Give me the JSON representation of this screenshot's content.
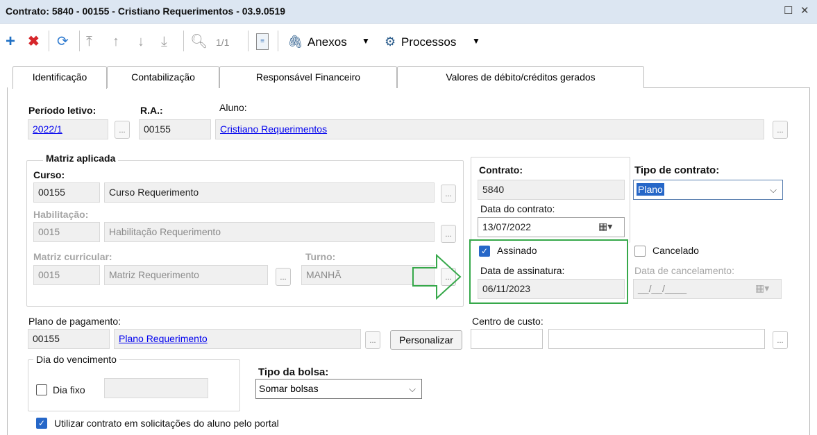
{
  "window": {
    "title": "Contrato: 5840 - 00155 - Cristiano Requerimentos - 03.9.0519"
  },
  "toolbar": {
    "record_counter": "1/1",
    "anexos_label": "Anexos",
    "processos_label": "Processos"
  },
  "tabs": [
    {
      "label": "Identificação"
    },
    {
      "label": "Contabilização"
    },
    {
      "label": "Responsável Financeiro"
    },
    {
      "label": "Valores de débito/créditos gerados"
    }
  ],
  "form": {
    "periodo_label": "Período letivo:",
    "periodo_value": "2022/1",
    "ra_label": "R.A.:",
    "ra_value": "00155",
    "aluno_label": "Aluno:",
    "aluno_value": "Cristiano Requerimentos",
    "matriz_title": "Matriz aplicada",
    "curso_label": "Curso:",
    "curso_code": "00155",
    "curso_name": "Curso Requerimento",
    "habilitacao_label": "Habilitação:",
    "habilitacao_code": "0015",
    "habilitacao_name": "Habilitação Requerimento",
    "matriz_label": "Matriz curricular:",
    "matriz_code": "0015",
    "matriz_name": "Matriz Requerimento",
    "turno_label": "Turno:",
    "turno_value": "MANHÃ",
    "contrato_label": "Contrato:",
    "contrato_value": "5840",
    "tipo_contrato_label": "Tipo de contrato:",
    "tipo_contrato_value": "Plano",
    "data_contrato_label": "Data do contrato:",
    "data_contrato_value": "13/07/2022",
    "assinado_label": "Assinado",
    "assinado_checked": true,
    "data_assinatura_label": "Data de assinatura:",
    "data_assinatura_value": "06/11/2023",
    "cancelado_label": "Cancelado",
    "data_cancelamento_label": "Data de cancelamento:",
    "data_cancelamento_value": "__/__/____",
    "plano_label": "Plano de pagamento:",
    "plano_code": "00155",
    "plano_name": "Plano Requerimento",
    "personalizar_label": "Personalizar",
    "centro_label": "Centro de custo:",
    "dia_venc_title": "Dia do vencimento",
    "dia_fixo_label": "Dia fixo",
    "tipo_bolsa_label": "Tipo da bolsa:",
    "tipo_bolsa_value": "Somar bolsas",
    "portal_label": "Utilizar contrato em solicitações do aluno pelo portal",
    "dots_label": "..."
  },
  "colors": {
    "accent": "#2667c8",
    "highlight": "#36a84a",
    "titlebar": "#dce6f2"
  }
}
